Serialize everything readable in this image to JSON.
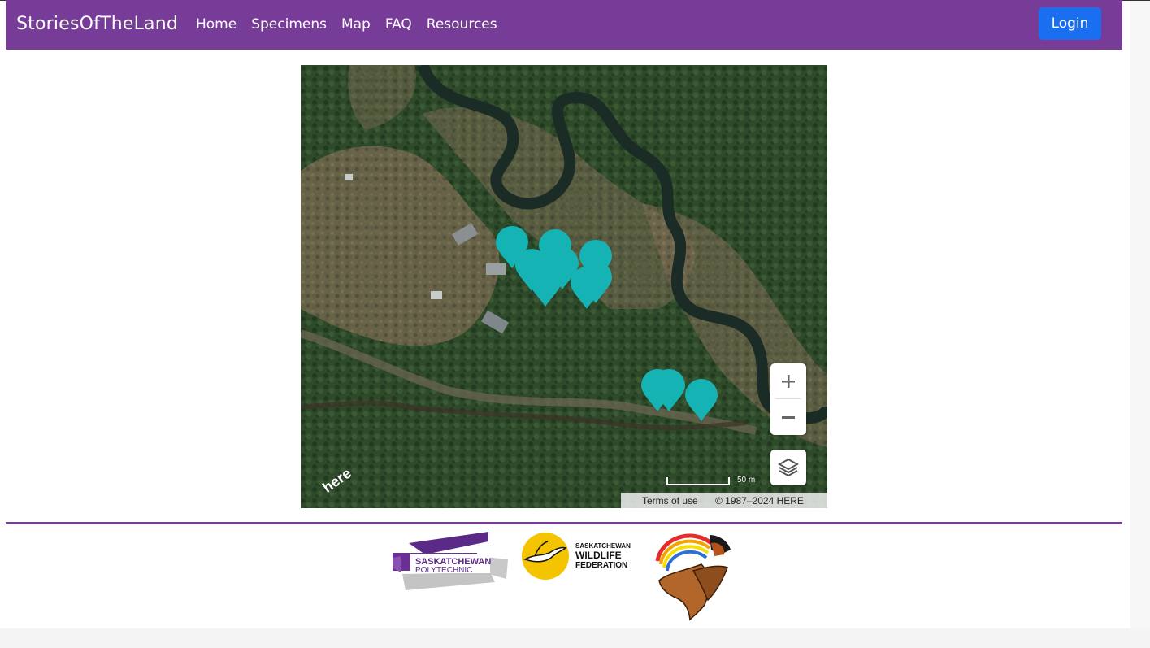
{
  "nav": {
    "brand": "StoriesOfTheLand",
    "links": [
      "Home",
      "Specimens",
      "Map",
      "FAQ",
      "Resources"
    ],
    "login_label": "Login",
    "accent_color": "#773c98",
    "button_color": "#1a6ff0"
  },
  "map": {
    "marker_color": "#16b3b5",
    "marker_count": 10,
    "zoom_in_icon": "plus-icon",
    "zoom_out_icon": "minus-icon",
    "layers_icon": "layers-icon",
    "scale_label": "50 m",
    "attribution": {
      "terms": "Terms of use",
      "copyright": "© 1987–2024 HERE"
    },
    "provider_logo": "here"
  },
  "footer": {
    "logos": [
      {
        "name": "Saskatchewan Polytechnic",
        "line1": "SASKATCHEWAN",
        "line2": "POLYTECHNIC"
      },
      {
        "name": "Saskatchewan Wildlife Federation",
        "line1": "SASKATCHEWAN",
        "line2": "WILDLIFE",
        "line3": "FEDERATION"
      },
      {
        "name": "Indigenous eagle logo"
      }
    ]
  }
}
